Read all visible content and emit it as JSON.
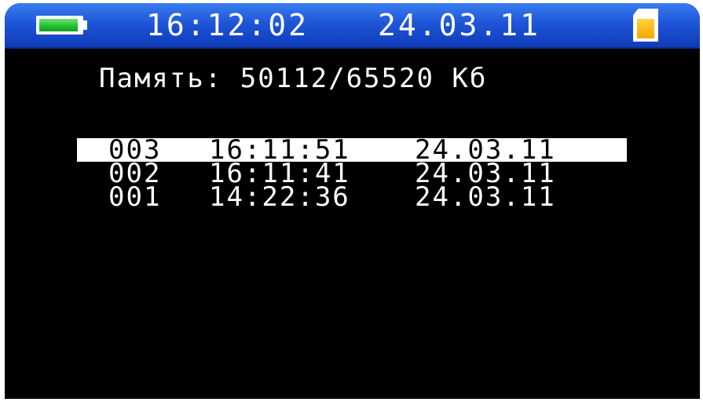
{
  "status_bar": {
    "time": "16:12:02",
    "date": "24.03.11",
    "battery_level": 0.95,
    "battery_icon": "battery-icon",
    "storage_icon": "sd-card-icon",
    "colors": {
      "bar": "#1e55d8",
      "battery_fill": "#1fbf2e",
      "sd_card": "#f0a800"
    }
  },
  "memory": {
    "text": "Память: 50112/65520 Кб"
  },
  "records": [
    {
      "num": "003",
      "time": "16:11:51",
      "date": "24.03.11",
      "selected": true
    },
    {
      "num": "002",
      "time": "16:11:41",
      "date": "24.03.11",
      "selected": false
    },
    {
      "num": "001",
      "time": "14:22:36",
      "date": "24.03.11",
      "selected": false
    }
  ]
}
